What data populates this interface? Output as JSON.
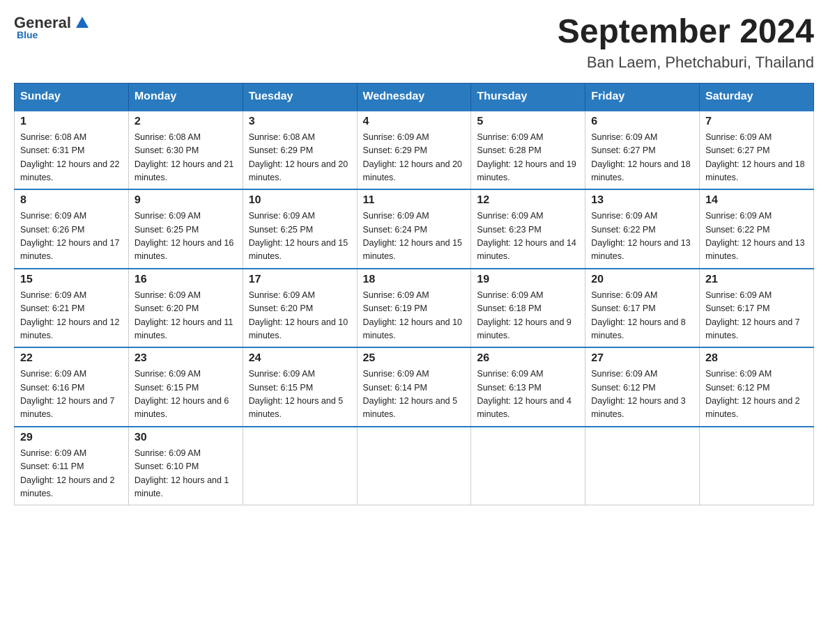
{
  "logo": {
    "general": "General",
    "blue": "Blue"
  },
  "calendar": {
    "title": "September 2024",
    "subtitle": "Ban Laem, Phetchaburi, Thailand"
  },
  "headers": [
    "Sunday",
    "Monday",
    "Tuesday",
    "Wednesday",
    "Thursday",
    "Friday",
    "Saturday"
  ],
  "weeks": [
    [
      {
        "day": "1",
        "sunrise": "6:08 AM",
        "sunset": "6:31 PM",
        "daylight": "12 hours and 22 minutes."
      },
      {
        "day": "2",
        "sunrise": "6:08 AM",
        "sunset": "6:30 PM",
        "daylight": "12 hours and 21 minutes."
      },
      {
        "day": "3",
        "sunrise": "6:08 AM",
        "sunset": "6:29 PM",
        "daylight": "12 hours and 20 minutes."
      },
      {
        "day": "4",
        "sunrise": "6:09 AM",
        "sunset": "6:29 PM",
        "daylight": "12 hours and 20 minutes."
      },
      {
        "day": "5",
        "sunrise": "6:09 AM",
        "sunset": "6:28 PM",
        "daylight": "12 hours and 19 minutes."
      },
      {
        "day": "6",
        "sunrise": "6:09 AM",
        "sunset": "6:27 PM",
        "daylight": "12 hours and 18 minutes."
      },
      {
        "day": "7",
        "sunrise": "6:09 AM",
        "sunset": "6:27 PM",
        "daylight": "12 hours and 18 minutes."
      }
    ],
    [
      {
        "day": "8",
        "sunrise": "6:09 AM",
        "sunset": "6:26 PM",
        "daylight": "12 hours and 17 minutes."
      },
      {
        "day": "9",
        "sunrise": "6:09 AM",
        "sunset": "6:25 PM",
        "daylight": "12 hours and 16 minutes."
      },
      {
        "day": "10",
        "sunrise": "6:09 AM",
        "sunset": "6:25 PM",
        "daylight": "12 hours and 15 minutes."
      },
      {
        "day": "11",
        "sunrise": "6:09 AM",
        "sunset": "6:24 PM",
        "daylight": "12 hours and 15 minutes."
      },
      {
        "day": "12",
        "sunrise": "6:09 AM",
        "sunset": "6:23 PM",
        "daylight": "12 hours and 14 minutes."
      },
      {
        "day": "13",
        "sunrise": "6:09 AM",
        "sunset": "6:22 PM",
        "daylight": "12 hours and 13 minutes."
      },
      {
        "day": "14",
        "sunrise": "6:09 AM",
        "sunset": "6:22 PM",
        "daylight": "12 hours and 13 minutes."
      }
    ],
    [
      {
        "day": "15",
        "sunrise": "6:09 AM",
        "sunset": "6:21 PM",
        "daylight": "12 hours and 12 minutes."
      },
      {
        "day": "16",
        "sunrise": "6:09 AM",
        "sunset": "6:20 PM",
        "daylight": "12 hours and 11 minutes."
      },
      {
        "day": "17",
        "sunrise": "6:09 AM",
        "sunset": "6:20 PM",
        "daylight": "12 hours and 10 minutes."
      },
      {
        "day": "18",
        "sunrise": "6:09 AM",
        "sunset": "6:19 PM",
        "daylight": "12 hours and 10 minutes."
      },
      {
        "day": "19",
        "sunrise": "6:09 AM",
        "sunset": "6:18 PM",
        "daylight": "12 hours and 9 minutes."
      },
      {
        "day": "20",
        "sunrise": "6:09 AM",
        "sunset": "6:17 PM",
        "daylight": "12 hours and 8 minutes."
      },
      {
        "day": "21",
        "sunrise": "6:09 AM",
        "sunset": "6:17 PM",
        "daylight": "12 hours and 7 minutes."
      }
    ],
    [
      {
        "day": "22",
        "sunrise": "6:09 AM",
        "sunset": "6:16 PM",
        "daylight": "12 hours and 7 minutes."
      },
      {
        "day": "23",
        "sunrise": "6:09 AM",
        "sunset": "6:15 PM",
        "daylight": "12 hours and 6 minutes."
      },
      {
        "day": "24",
        "sunrise": "6:09 AM",
        "sunset": "6:15 PM",
        "daylight": "12 hours and 5 minutes."
      },
      {
        "day": "25",
        "sunrise": "6:09 AM",
        "sunset": "6:14 PM",
        "daylight": "12 hours and 5 minutes."
      },
      {
        "day": "26",
        "sunrise": "6:09 AM",
        "sunset": "6:13 PM",
        "daylight": "12 hours and 4 minutes."
      },
      {
        "day": "27",
        "sunrise": "6:09 AM",
        "sunset": "6:12 PM",
        "daylight": "12 hours and 3 minutes."
      },
      {
        "day": "28",
        "sunrise": "6:09 AM",
        "sunset": "6:12 PM",
        "daylight": "12 hours and 2 minutes."
      }
    ],
    [
      {
        "day": "29",
        "sunrise": "6:09 AM",
        "sunset": "6:11 PM",
        "daylight": "12 hours and 2 minutes."
      },
      {
        "day": "30",
        "sunrise": "6:09 AM",
        "sunset": "6:10 PM",
        "daylight": "12 hours and 1 minute."
      },
      null,
      null,
      null,
      null,
      null
    ]
  ]
}
